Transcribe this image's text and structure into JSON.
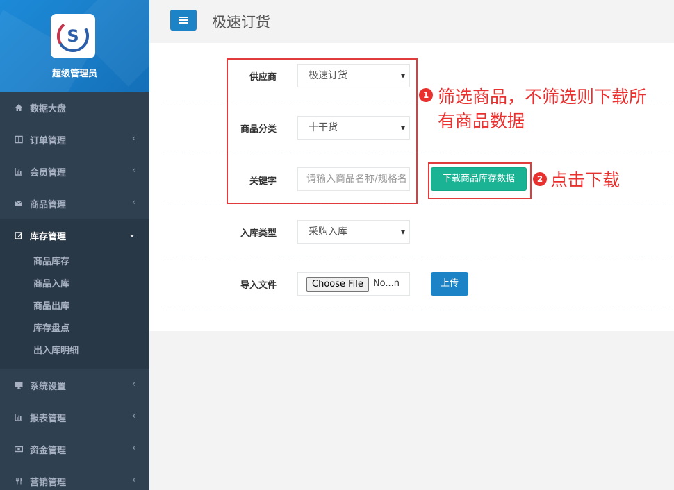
{
  "sidebar": {
    "profile_name": "超级管理员",
    "logo": "s-logo",
    "items": [
      {
        "label": "数据大盘",
        "icon": "home-icon"
      },
      {
        "label": "订单管理",
        "icon": "columns-icon"
      },
      {
        "label": "会员管理",
        "icon": "bar-chart-icon"
      },
      {
        "label": "商品管理",
        "icon": "envelope-icon"
      },
      {
        "label": "库存管理",
        "icon": "edit-icon"
      },
      {
        "label": "系统设置",
        "icon": "monitor-icon"
      },
      {
        "label": "报表管理",
        "icon": "bar-chart-icon"
      },
      {
        "label": "资金管理",
        "icon": "money-icon"
      },
      {
        "label": "营销管理",
        "icon": "cutlery-icon"
      }
    ],
    "submenu": [
      "商品库存",
      "商品入库",
      "商品出库",
      "库存盘点",
      "出入库明细"
    ]
  },
  "header": {
    "title": "极速订货"
  },
  "form": {
    "supplier_label": "供应商",
    "supplier_value": "极速订货",
    "category_label": "商品分类",
    "category_value": "十干货",
    "keyword_label": "关键字",
    "keyword_placeholder": "请输入商品名称/规格名",
    "download_button": "下载商品库存数据",
    "stockin_type_label": "入库类型",
    "stockin_type_value": "采购入库",
    "import_label": "导入文件",
    "choose_file": "Choose File",
    "file_status": "No...n",
    "upload_button": "上传"
  },
  "annotations": {
    "badge1": "1",
    "text1_line1": "筛选商品，不筛选则下载所",
    "text1_line2": "有商品数据",
    "badge2": "2",
    "text2": "点击下载"
  },
  "colors": {
    "sidebar_bg": "#2f4050",
    "profile_bg": "#1c84c6",
    "primary": "#1c84c6",
    "success": "#1ab394",
    "annotation": "#e8302f"
  }
}
